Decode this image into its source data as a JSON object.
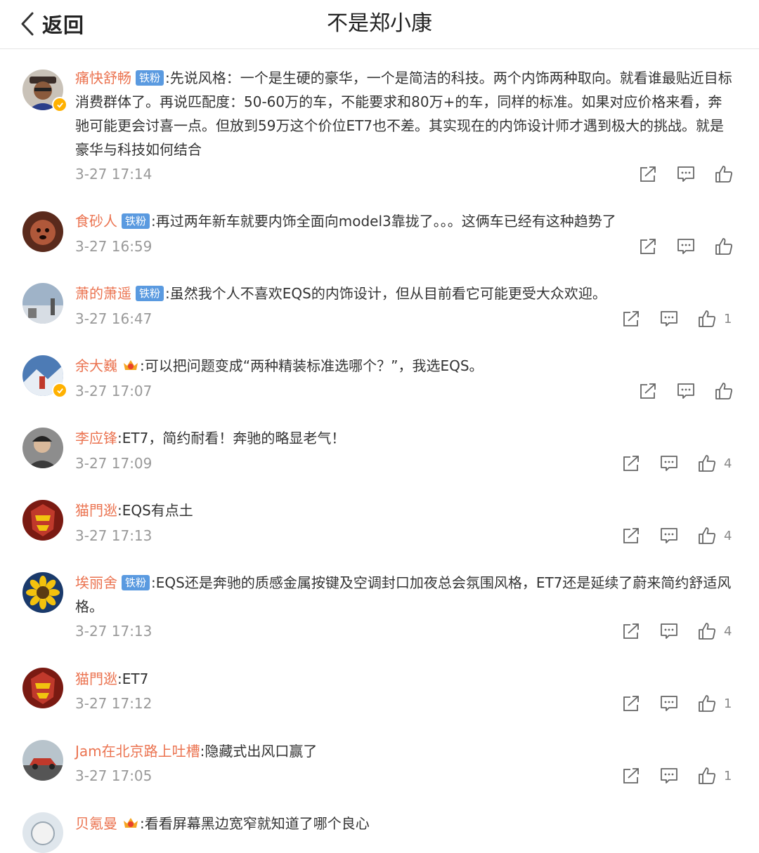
{
  "header": {
    "back_label": "返回",
    "title": "不是郑小康"
  },
  "colors": {
    "username": "#eb7350",
    "fan_badge": "#5a9ae0",
    "verified": "#ffb100"
  },
  "comments": [
    {
      "user": "痛快舒畅",
      "badge": "铁粉",
      "text": ":先说风格：一个是生硬的豪华，一个是简洁的科技。两个内饰两种取向。就看谁最贴近目标消费群体了。再说匹配度：50-60万的车，不能要求和80万+的车，同样的标准。如果对应价格来看，奔驰可能更会讨喜一点。但放到59万这个价位ET7也不差。其实现在的内饰设计师才遇到极大的挑战。就是豪华与科技如何结合",
      "time": "3-27 17:14",
      "likes": ""
    },
    {
      "user": "食砂人",
      "badge": "铁粉",
      "text": ":再过两年新车就要内饰全面向model3靠拢了。。。这俩车已经有这种趋势了",
      "time": "3-27 16:59",
      "likes": ""
    },
    {
      "user": "萧的萧遥",
      "badge": "铁粉",
      "text": ":虽然我个人不喜欢EQS的内饰设计，但从目前看它可能更受大众欢迎。",
      "time": "3-27 16:47",
      "likes": "1"
    },
    {
      "user": "余大巍",
      "badge": "",
      "text": ":可以把问题变成“两种精装标准选哪个？”，我选EQS。",
      "time": "3-27 17:07",
      "likes": ""
    },
    {
      "user": "李应锋",
      "badge": "",
      "text": ":ET7，简约耐看！奔驰的略显老气！",
      "time": "3-27 17:09",
      "likes": "4"
    },
    {
      "user": "猫門逖",
      "badge": "",
      "text": ":EQS有点土",
      "time": "3-27 17:13",
      "likes": "4"
    },
    {
      "user": "埃丽舍",
      "badge": "铁粉",
      "text": ":EQS还是奔驰的质感金属按键及空调封口加夜总会氛围风格，ET7还是延续了蔚来简约舒适风格。",
      "time": "3-27 17:13",
      "likes": "4"
    },
    {
      "user": "猫門逖",
      "badge": "",
      "text": ":ET7",
      "time": "3-27 17:12",
      "likes": "1"
    },
    {
      "user": "Jam在北京路上吐槽",
      "badge": "",
      "text": ":隐藏式出风口赢了",
      "time": "3-27 17:05",
      "likes": "1"
    },
    {
      "user": "贝氪曼",
      "badge": "",
      "text": ":看看屏幕黑边宽窄就知道了哪个良心",
      "time": "",
      "likes": ""
    }
  ]
}
